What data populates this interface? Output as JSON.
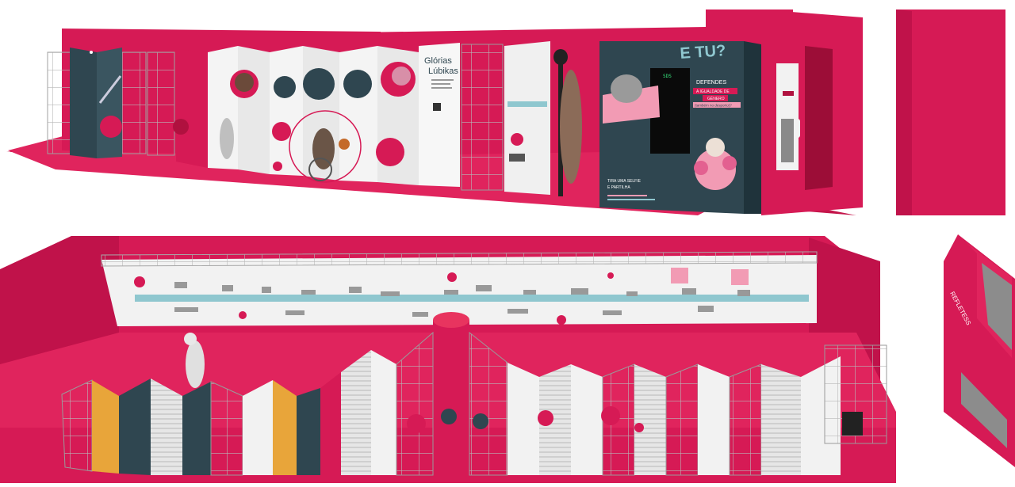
{
  "colors": {
    "magenta": "#d61a55",
    "magenta_dark": "#b0113f",
    "magenta_floor": "#e0245d",
    "teal": "#2f4650",
    "panel_white": "#f2f2f2",
    "pink_light": "#f29bb4",
    "orange": "#e8a53a"
  },
  "booth_top": {
    "glorias_title_line1": "Glórias",
    "glorias_title_line2": "Lúbikas",
    "etu_heading": "E TU?",
    "defendes_line1": "DEFENDES",
    "defendes_line2": "A IGUALDADE DE",
    "defendes_line3": "GÉNERO",
    "defendes_line4": "(também no desporto)?",
    "selfie_line1": "TIRA UMA SELFIE",
    "selfie_line2": "E PARTILHA",
    "screen_text": "SDS"
  },
  "side_box": {
    "vertical_label": "REFLETESS"
  }
}
